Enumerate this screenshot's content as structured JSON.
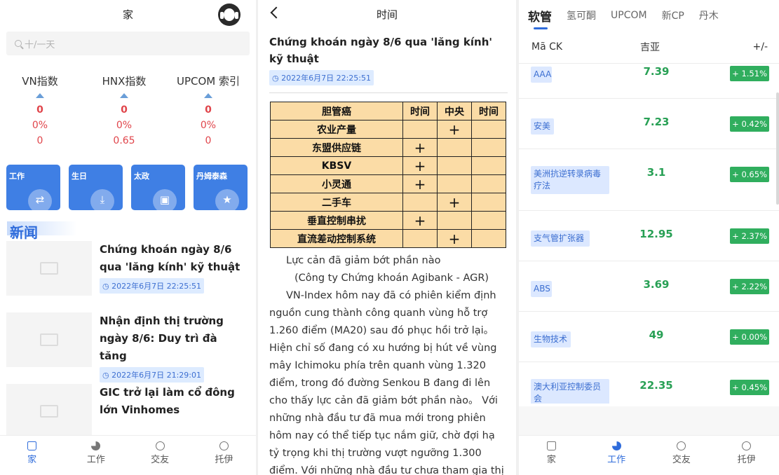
{
  "home": {
    "title": "家",
    "search_placeholder": "十/一天",
    "indices": [
      {
        "name": "VN指数",
        "value": "0",
        "pct": "0%",
        "change": "0"
      },
      {
        "name": "HNX指数",
        "value": "0",
        "pct": "0%",
        "change": "0.65"
      },
      {
        "name": "UPCOM 索引",
        "value": "0",
        "pct": "0%",
        "change": "0"
      }
    ],
    "cards": [
      "工作",
      "生日",
      "太政",
      "丹姆泰森"
    ],
    "news_heading": "新闻",
    "news": [
      {
        "title": "Chứng khoán ngày 8/6 qua 'lăng kính' kỹ thuật",
        "date": "2022年6月7日 22:25:51"
      },
      {
        "title": "Nhận định thị trường ngày 8/6: Duy trì đà tăng",
        "date": "2022年6月7日 21:29:01"
      },
      {
        "title": "GIC trở lại làm cổ đông lớn Vinhomes",
        "date": ""
      }
    ],
    "tabs": [
      "家",
      "工作",
      "交友",
      "托伊"
    ]
  },
  "article": {
    "header": "时间",
    "title": "Chứng khoán ngày 8/6 qua 'lăng kính' kỹ thuật",
    "date": "2022年6月7日 22:25:51",
    "table": {
      "headers": [
        "胆管癌",
        "时间",
        "中央",
        "时间"
      ],
      "rows": [
        {
          "label": "农业产量",
          "marks": [
            "",
            "+",
            ""
          ]
        },
        {
          "label": "东盟供应链",
          "marks": [
            "+",
            "",
            ""
          ]
        },
        {
          "label": "KBSV",
          "marks": [
            "+",
            "",
            ""
          ]
        },
        {
          "label": "小灵通",
          "marks": [
            "+",
            "",
            ""
          ]
        },
        {
          "label": "二手车",
          "marks": [
            "",
            "+",
            ""
          ]
        },
        {
          "label": "垂直控制串扰",
          "marks": [
            "+",
            "",
            ""
          ]
        },
        {
          "label": "直流差动控制系统",
          "marks": [
            "",
            "+",
            ""
          ]
        }
      ]
    },
    "line1": "Lực cản đã giảm bớt phần nào",
    "line2": "(Công ty Chứng khoán Agibank - AGR)",
    "body": "VN-Index hôm nay đã có phiên kiểm định nguồn cung thành công quanh vùng hỗ trợ 1.260 điểm (MA20) sau đó phục hồi trở lại。Hiện chỉ số đang có xu hướng bị hút về vùng mây Ichimoku phía trên quanh vùng 1.320 điểm, trong đó đường Senkou B đang đi lên cho thấy lực cản đã giảm bớt phần nào。 Với những nhà đầu tư đã mua mới trong phiên hôm nay có thể tiếp tục nắm giữ, chờ đợi hạ tỷ trọng khi thị trường vượt ngưỡng 1.300 điểm. Với những nhà đầu tư chưa tham gia thị"
  },
  "market": {
    "tabs": [
      "软管",
      "氢可酮",
      "UPCOM",
      "新CP",
      "丹木"
    ],
    "col_headers": {
      "name": "Mã CK",
      "price": "吉亚",
      "change": "+/-"
    },
    "stocks": [
      {
        "name": "AAA",
        "price": "7.39",
        "change": "+ 1.51%"
      },
      {
        "name": "安美",
        "price": "7.23",
        "change": "+ 0.42%"
      },
      {
        "name": "美洲抗逆转录病毒疗法",
        "price": "3.1",
        "change": "+ 0.65%"
      },
      {
        "name": "支气管扩张器",
        "price": "12.95",
        "change": "+ 2.37%"
      },
      {
        "name": "ABS",
        "price": "3.69",
        "change": "+ 2.22%"
      },
      {
        "name": "生物技术",
        "price": "49",
        "change": "+ 0.00%"
      },
      {
        "name": "澳大利亚控制委员会",
        "price": "22.35",
        "change": "+ 0.45%"
      }
    ],
    "bottom_tabs": [
      "家",
      "工作",
      "交友",
      "托伊"
    ]
  },
  "colors": {
    "accent": "#2f6cdb",
    "up": "#30ae5e",
    "down": "#e0454b",
    "card": "#3f7fe4",
    "table_bg": "#fbdca6"
  }
}
